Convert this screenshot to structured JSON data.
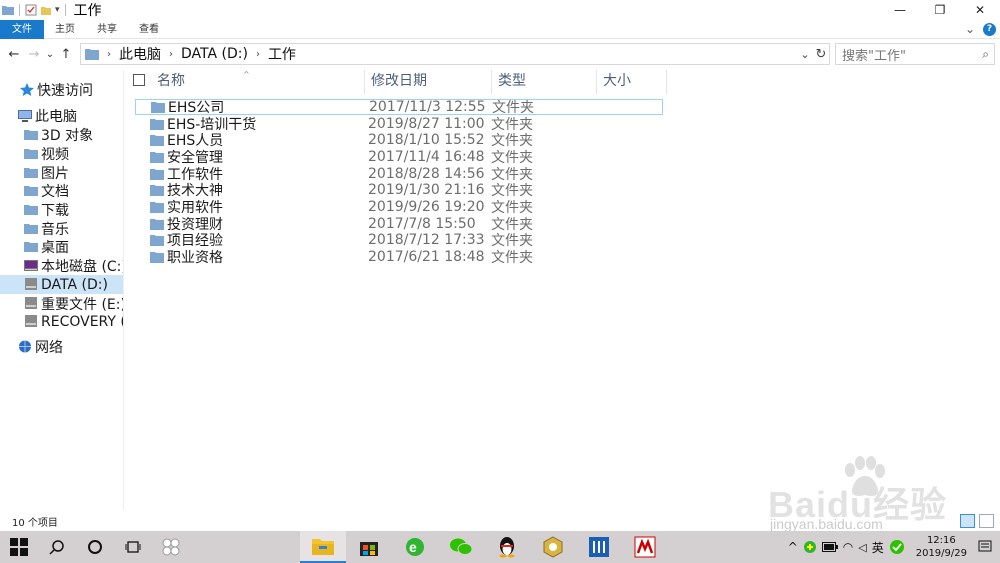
{
  "window": {
    "title": "工作",
    "minimize_glyph": "—",
    "maximize_glyph": "❐",
    "close_glyph": "✕"
  },
  "ribbon": {
    "tabs": [
      "文件",
      "主页",
      "共享",
      "查看"
    ],
    "expand_glyph": "⌄",
    "help_glyph": "?"
  },
  "address": {
    "back_glyph": "←",
    "forward_glyph": "→",
    "recent_glyph": "⌄",
    "up_glyph": "↑",
    "crumbs": [
      "此电脑",
      "DATA (D:)",
      "工作"
    ],
    "sep_glyph": "›",
    "dropdown_glyph": "⌄",
    "refresh_glyph": "↻",
    "search_placeholder": "搜索\"工作\"",
    "search_glyph": "⌕"
  },
  "nav": {
    "items": [
      {
        "label": "快速访问",
        "icon": "star-icon"
      },
      {
        "label": "此电脑",
        "icon": "computer-icon"
      },
      {
        "label": "3D 对象",
        "icon": "folder-icon"
      },
      {
        "label": "视频",
        "icon": "folder-icon"
      },
      {
        "label": "图片",
        "icon": "folder-icon"
      },
      {
        "label": "文档",
        "icon": "folder-icon"
      },
      {
        "label": "下载",
        "icon": "folder-icon"
      },
      {
        "label": "音乐",
        "icon": "folder-icon"
      },
      {
        "label": "桌面",
        "icon": "folder-icon"
      },
      {
        "label": "本地磁盘 (C:)",
        "icon": "windows-drive-icon"
      },
      {
        "label": "DATA (D:)",
        "icon": "drive-icon"
      },
      {
        "label": "重要文件 (E:)",
        "icon": "drive-icon"
      },
      {
        "label": "RECOVERY (",
        "icon": "drive-icon"
      },
      {
        "label": "网络",
        "icon": "network-icon"
      }
    ]
  },
  "list": {
    "columns": [
      "名称",
      "修改日期",
      "类型",
      "大小"
    ],
    "sort_glyph": "^",
    "rows": [
      {
        "name": "EHS公司",
        "date": "2017/11/3 12:55",
        "type": "文件夹"
      },
      {
        "name": "EHS-培训干货",
        "date": "2019/8/27 11:00",
        "type": "文件夹"
      },
      {
        "name": "EHS人员",
        "date": "2018/1/10 15:52",
        "type": "文件夹"
      },
      {
        "name": "安全管理",
        "date": "2017/11/4 16:48",
        "type": "文件夹"
      },
      {
        "name": "工作软件",
        "date": "2018/8/28 14:56",
        "type": "文件夹"
      },
      {
        "name": "技术大神",
        "date": "2019/1/30 21:16",
        "type": "文件夹"
      },
      {
        "name": "实用软件",
        "date": "2019/9/26 19:20",
        "type": "文件夹"
      },
      {
        "name": "投资理财",
        "date": "2017/7/8 15:50",
        "type": "文件夹"
      },
      {
        "name": "项目经验",
        "date": "2018/7/12 17:33",
        "type": "文件夹"
      },
      {
        "name": "职业资格",
        "date": "2017/6/21 18:48",
        "type": "文件夹"
      }
    ]
  },
  "status": {
    "count": "10 个项目"
  },
  "taskbar": {
    "tray_up_glyph": "^",
    "ime": "英",
    "time": "12:16",
    "date": "2019/9/29",
    "wifi_glyph": "◠",
    "speaker_glyph": "◁"
  },
  "watermark": {
    "text": "Baidu经验",
    "sub": "jingyan.baidu.com"
  },
  "colors": {
    "accent": "#1979ca",
    "folder": "#7ea6cf",
    "selection": "#cce4f7",
    "taskbar": "#d4cfd0"
  }
}
